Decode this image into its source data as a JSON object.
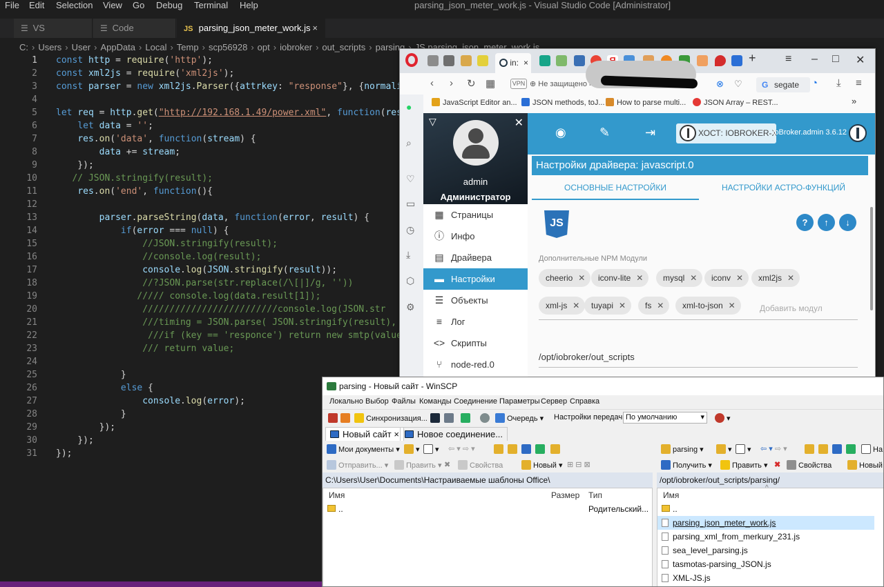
{
  "vscode": {
    "menu": [
      "File",
      "Edit",
      "Selection",
      "View",
      "Go",
      "Debug",
      "Terminal",
      "Help"
    ],
    "title": "parsing_json_meter_work.js - Visual Studio Code [Administrator]",
    "tabs": [
      {
        "label": "VS",
        "icon": "file-icon"
      },
      {
        "label": "Code",
        "icon": "file-icon"
      },
      {
        "label": "parsing_json_meter_work.js",
        "icon": "js-icon",
        "close": "×"
      }
    ],
    "breadcrumb": [
      "C:",
      "Users",
      "User",
      "AppData",
      "Local",
      "Temp",
      "scp56928",
      "opt",
      "iobroker",
      "out_scripts",
      "parsing",
      "JS parsing_json_meter_work.js"
    ],
    "colors": {
      "keyword": "#569cd6",
      "string": "#ce9178",
      "comment": "#6a9955",
      "function": "#dcdcaa",
      "variable": "#9cdcfe"
    },
    "lines": [
      {
        "n": "1",
        "segs": [
          [
            "kw",
            "const "
          ],
          [
            "id",
            "http"
          ],
          [
            "pl",
            " = "
          ],
          [
            "fn",
            "require"
          ],
          [
            "pl",
            "("
          ],
          [
            "str",
            "'http'"
          ],
          [
            "pl",
            ");"
          ]
        ]
      },
      {
        "n": "2",
        "segs": [
          [
            "kw",
            "const "
          ],
          [
            "id",
            "xml2js"
          ],
          [
            "pl",
            " = "
          ],
          [
            "fn",
            "require"
          ],
          [
            "pl",
            "("
          ],
          [
            "str",
            "'xml2js'"
          ],
          [
            "pl",
            ");"
          ]
        ]
      },
      {
        "n": "3",
        "segs": [
          [
            "kw",
            "const "
          ],
          [
            "id",
            "parser"
          ],
          [
            "pl",
            " = "
          ],
          [
            "kw",
            "new "
          ],
          [
            "id",
            "xml2js"
          ],
          [
            "pl",
            "."
          ],
          [
            "fn",
            "Parser"
          ],
          [
            "pl",
            "({"
          ],
          [
            "id",
            "attrkey"
          ],
          [
            "pl",
            ": "
          ],
          [
            "str",
            "\"response\""
          ],
          [
            "pl",
            "}, {"
          ],
          [
            "id",
            "normali"
          ]
        ]
      },
      {
        "n": "4",
        "segs": []
      },
      {
        "n": "5",
        "segs": [
          [
            "kw",
            "let "
          ],
          [
            "id",
            "req"
          ],
          [
            "pl",
            " = "
          ],
          [
            "id",
            "http"
          ],
          [
            "pl",
            "."
          ],
          [
            "fn",
            "get"
          ],
          [
            "pl",
            "("
          ],
          [
            "url",
            "\"http://192.168.1.49/power.xml\""
          ],
          [
            "pl",
            ", "
          ],
          [
            "kw",
            "function"
          ],
          [
            "pl",
            "("
          ],
          [
            "id",
            "res"
          ]
        ]
      },
      {
        "n": "6",
        "segs": [
          [
            "pl",
            "    "
          ],
          [
            "kw",
            "let "
          ],
          [
            "id",
            "data"
          ],
          [
            "pl",
            " = "
          ],
          [
            "str",
            "''"
          ],
          [
            "pl",
            ";"
          ]
        ]
      },
      {
        "n": "7",
        "segs": [
          [
            "pl",
            "    "
          ],
          [
            "id",
            "res"
          ],
          [
            "pl",
            "."
          ],
          [
            "fn",
            "on"
          ],
          [
            "pl",
            "("
          ],
          [
            "str",
            "'data'"
          ],
          [
            "pl",
            ", "
          ],
          [
            "kw",
            "function"
          ],
          [
            "pl",
            "("
          ],
          [
            "id",
            "stream"
          ],
          [
            "pl",
            ") {"
          ]
        ]
      },
      {
        "n": "8",
        "segs": [
          [
            "pl",
            "        "
          ],
          [
            "id",
            "data"
          ],
          [
            "pl",
            " += "
          ],
          [
            "id",
            "stream"
          ],
          [
            "pl",
            ";"
          ]
        ]
      },
      {
        "n": "9",
        "segs": [
          [
            "pl",
            "    });"
          ]
        ]
      },
      {
        "n": "10",
        "segs": [
          [
            "pl",
            "   "
          ],
          [
            "cm",
            "// JSON.stringify(result);"
          ]
        ]
      },
      {
        "n": "11",
        "segs": [
          [
            "pl",
            "    "
          ],
          [
            "id",
            "res"
          ],
          [
            "pl",
            "."
          ],
          [
            "fn",
            "on"
          ],
          [
            "pl",
            "("
          ],
          [
            "str",
            "'end'"
          ],
          [
            "pl",
            ", "
          ],
          [
            "kw",
            "function"
          ],
          [
            "pl",
            "(){"
          ]
        ]
      },
      {
        "n": "12",
        "segs": []
      },
      {
        "n": "13",
        "segs": [
          [
            "pl",
            "        "
          ],
          [
            "id",
            "parser"
          ],
          [
            "pl",
            "."
          ],
          [
            "fn",
            "parseString"
          ],
          [
            "pl",
            "("
          ],
          [
            "id",
            "data"
          ],
          [
            "pl",
            ", "
          ],
          [
            "kw",
            "function"
          ],
          [
            "pl",
            "("
          ],
          [
            "id",
            "error"
          ],
          [
            "pl",
            ", "
          ],
          [
            "id",
            "result"
          ],
          [
            "pl",
            ") {"
          ]
        ]
      },
      {
        "n": "14",
        "segs": [
          [
            "pl",
            "            "
          ],
          [
            "kw",
            "if"
          ],
          [
            "pl",
            "("
          ],
          [
            "id",
            "error"
          ],
          [
            "pl",
            " === "
          ],
          [
            "kw",
            "null"
          ],
          [
            "pl",
            ") {"
          ]
        ]
      },
      {
        "n": "15",
        "segs": [
          [
            "pl",
            "                "
          ],
          [
            "cm",
            "//JSON.stringify(result);"
          ]
        ]
      },
      {
        "n": "16",
        "segs": [
          [
            "pl",
            "                "
          ],
          [
            "cm",
            "//console.log(result);"
          ]
        ]
      },
      {
        "n": "17",
        "segs": [
          [
            "pl",
            "                "
          ],
          [
            "id",
            "console"
          ],
          [
            "pl",
            "."
          ],
          [
            "fn",
            "log"
          ],
          [
            "pl",
            "("
          ],
          [
            "id",
            "JSON"
          ],
          [
            "pl",
            "."
          ],
          [
            "fn",
            "stringify"
          ],
          [
            "pl",
            "("
          ],
          [
            "id",
            "result"
          ],
          [
            "pl",
            "));"
          ]
        ]
      },
      {
        "n": "18",
        "segs": [
          [
            "pl",
            "                "
          ],
          [
            "cm",
            "//?JSON.parse(str.replace(/\\[|]/g, ''))"
          ]
        ]
      },
      {
        "n": "19",
        "segs": [
          [
            "pl",
            "               "
          ],
          [
            "cm",
            "///// console.log(data.result[1]);"
          ]
        ]
      },
      {
        "n": "20",
        "segs": [
          [
            "pl",
            "                "
          ],
          [
            "cm",
            "/////////////////////////console.log(JSON.str"
          ]
        ]
      },
      {
        "n": "21",
        "segs": [
          [
            "pl",
            "                "
          ],
          [
            "cm",
            "///timing = JSON.parse( JSON.stringify(result),"
          ]
        ]
      },
      {
        "n": "22",
        "segs": [
          [
            "pl",
            "                 "
          ],
          [
            "cm",
            "///if (key == 'responce') return new smtp(value"
          ]
        ]
      },
      {
        "n": "23",
        "segs": [
          [
            "pl",
            "                "
          ],
          [
            "cm",
            "/// return value;"
          ]
        ]
      },
      {
        "n": "24",
        "segs": []
      },
      {
        "n": "25",
        "segs": [
          [
            "pl",
            "            }"
          ]
        ]
      },
      {
        "n": "26",
        "segs": [
          [
            "pl",
            "            "
          ],
          [
            "kw",
            "else"
          ],
          [
            "pl",
            " {"
          ]
        ]
      },
      {
        "n": "27",
        "segs": [
          [
            "pl",
            "                "
          ],
          [
            "id",
            "console"
          ],
          [
            "pl",
            "."
          ],
          [
            "fn",
            "log"
          ],
          [
            "pl",
            "("
          ],
          [
            "id",
            "error"
          ],
          [
            "pl",
            ");"
          ]
        ]
      },
      {
        "n": "28",
        "segs": [
          [
            "pl",
            "            }"
          ]
        ]
      },
      {
        "n": "29",
        "segs": [
          [
            "pl",
            "        });"
          ]
        ]
      },
      {
        "n": "30",
        "segs": [
          [
            "pl",
            "    });"
          ]
        ]
      },
      {
        "n": "31",
        "segs": [
          [
            "pl",
            "});"
          ]
        ]
      }
    ]
  },
  "browser": {
    "active_tab": "in:",
    "tab_close": "×",
    "vpn": "VPN",
    "not_secure": "Не защищено",
    "url_prefix": "ht",
    "search_query": "segate",
    "bookmarks": [
      "JavaScript Editor an...",
      "JSON methods, toJ...",
      "How to parse multi...",
      "JSON Array – REST..."
    ],
    "more": "»",
    "iobroker": {
      "username": "admin",
      "role": "Администратор",
      "host": "ХОСТ: IOBROKER-X",
      "version": "ioBroker.admin 3.6.12",
      "nav": [
        {
          "label": "Страницы",
          "icon": "grid-icon",
          "glyph": "▦"
        },
        {
          "label": "Инфо",
          "icon": "info-icon",
          "glyph": "ⓘ"
        },
        {
          "label": "Драйвера",
          "icon": "store-icon",
          "glyph": "▤"
        },
        {
          "label": "Настройки",
          "icon": "settings-icon",
          "glyph": "▬",
          "active": true
        },
        {
          "label": "Объекты",
          "icon": "list-icon",
          "glyph": "☰"
        },
        {
          "label": "Лог",
          "icon": "log-icon",
          "glyph": "≡"
        },
        {
          "label": "Скрипты",
          "icon": "code-icon",
          "glyph": "<>"
        },
        {
          "label": "node-red.0",
          "icon": "node-red-icon",
          "glyph": "⑂"
        }
      ],
      "config_title": "Настройки драйвера: javascript.0",
      "tabs": [
        "ОСНОВНЫЕ НАСТРОЙКИ",
        "НАСТРОЙКИ АСТРО-ФУНКЦИЙ"
      ],
      "js_logo": "JS",
      "npm_label": "Дополнительные NPM Модули",
      "modules": [
        "cheerio",
        "iconv-lite",
        "mysql",
        "iconv",
        "xml2js",
        "xml-js",
        "tuyapi",
        "fs",
        "xml-to-json"
      ],
      "add_placeholder": "Добавить модул",
      "scripts_path": "/opt/iobroker/out_scripts",
      "brand_color": "#3399cc"
    }
  },
  "winscp": {
    "title": "parsing - Новый сайт - WinSCP",
    "menu": [
      "Локально",
      "Выбор",
      "Файлы",
      "Команды",
      "Соединение",
      "Параметры",
      "Сервер",
      "Справка"
    ],
    "toolbar": {
      "sync": "Синхронизация...",
      "queue": "Очередь",
      "transfer_settings": "Настройки передачи",
      "transfer_mode": "По умолчанию"
    },
    "tabs": [
      "Новый сайт",
      "Новое соединение..."
    ],
    "tab_close": "×",
    "left": {
      "location": "Мои документы",
      "send": "Отправить...",
      "edit": "Править",
      "properties": "Свойства",
      "new": "Новый",
      "path": "C:\\Users\\User\\Documents\\Настраиваемые шаблоны Office\\",
      "columns": [
        "Имя",
        "Размер",
        "Тип"
      ],
      "rows": [
        {
          "name": "..",
          "type": "Родительский..."
        }
      ]
    },
    "right": {
      "location": "parsing",
      "receive": "Получить",
      "edit": "Править",
      "properties": "Свойства",
      "new": "Новый",
      "path": "/opt/iobroker/out_scripts/parsing/",
      "columns": [
        "Имя"
      ],
      "rows": [
        "..",
        "parsing_json_meter_work.js",
        "parsing_xml_from_merkury_231.js",
        "sea_level_parsing.js",
        "tasmotas-parsing_JSON.js",
        "XML-JS.js"
      ],
      "cut_label": "Ha"
    }
  }
}
